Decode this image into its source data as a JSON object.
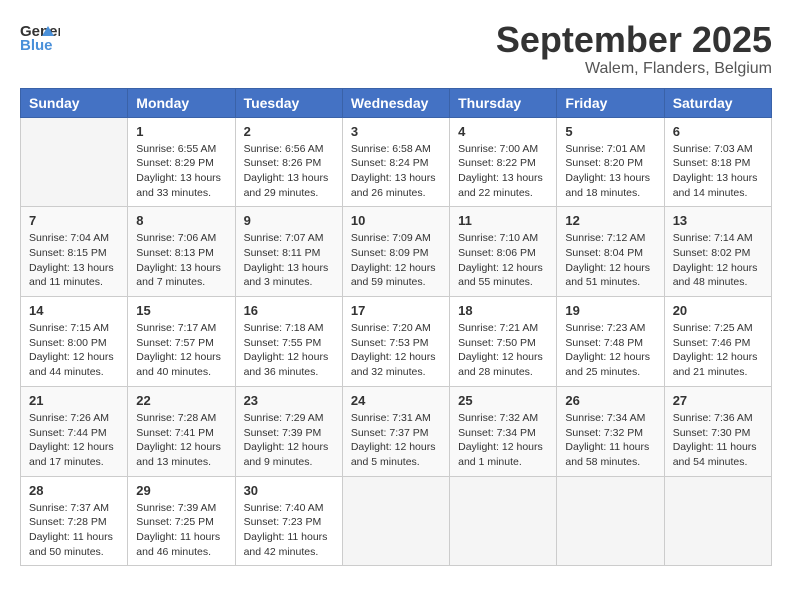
{
  "logo": {
    "general": "General",
    "blue": "Blue"
  },
  "header": {
    "month": "September 2025",
    "location": "Walem, Flanders, Belgium"
  },
  "weekdays": [
    "Sunday",
    "Monday",
    "Tuesday",
    "Wednesday",
    "Thursday",
    "Friday",
    "Saturday"
  ],
  "weeks": [
    [
      {
        "day": "",
        "info": ""
      },
      {
        "day": "1",
        "info": "Sunrise: 6:55 AM\nSunset: 8:29 PM\nDaylight: 13 hours\nand 33 minutes."
      },
      {
        "day": "2",
        "info": "Sunrise: 6:56 AM\nSunset: 8:26 PM\nDaylight: 13 hours\nand 29 minutes."
      },
      {
        "day": "3",
        "info": "Sunrise: 6:58 AM\nSunset: 8:24 PM\nDaylight: 13 hours\nand 26 minutes."
      },
      {
        "day": "4",
        "info": "Sunrise: 7:00 AM\nSunset: 8:22 PM\nDaylight: 13 hours\nand 22 minutes."
      },
      {
        "day": "5",
        "info": "Sunrise: 7:01 AM\nSunset: 8:20 PM\nDaylight: 13 hours\nand 18 minutes."
      },
      {
        "day": "6",
        "info": "Sunrise: 7:03 AM\nSunset: 8:18 PM\nDaylight: 13 hours\nand 14 minutes."
      }
    ],
    [
      {
        "day": "7",
        "info": "Sunrise: 7:04 AM\nSunset: 8:15 PM\nDaylight: 13 hours\nand 11 minutes."
      },
      {
        "day": "8",
        "info": "Sunrise: 7:06 AM\nSunset: 8:13 PM\nDaylight: 13 hours\nand 7 minutes."
      },
      {
        "day": "9",
        "info": "Sunrise: 7:07 AM\nSunset: 8:11 PM\nDaylight: 13 hours\nand 3 minutes."
      },
      {
        "day": "10",
        "info": "Sunrise: 7:09 AM\nSunset: 8:09 PM\nDaylight: 12 hours\nand 59 minutes."
      },
      {
        "day": "11",
        "info": "Sunrise: 7:10 AM\nSunset: 8:06 PM\nDaylight: 12 hours\nand 55 minutes."
      },
      {
        "day": "12",
        "info": "Sunrise: 7:12 AM\nSunset: 8:04 PM\nDaylight: 12 hours\nand 51 minutes."
      },
      {
        "day": "13",
        "info": "Sunrise: 7:14 AM\nSunset: 8:02 PM\nDaylight: 12 hours\nand 48 minutes."
      }
    ],
    [
      {
        "day": "14",
        "info": "Sunrise: 7:15 AM\nSunset: 8:00 PM\nDaylight: 12 hours\nand 44 minutes."
      },
      {
        "day": "15",
        "info": "Sunrise: 7:17 AM\nSunset: 7:57 PM\nDaylight: 12 hours\nand 40 minutes."
      },
      {
        "day": "16",
        "info": "Sunrise: 7:18 AM\nSunset: 7:55 PM\nDaylight: 12 hours\nand 36 minutes."
      },
      {
        "day": "17",
        "info": "Sunrise: 7:20 AM\nSunset: 7:53 PM\nDaylight: 12 hours\nand 32 minutes."
      },
      {
        "day": "18",
        "info": "Sunrise: 7:21 AM\nSunset: 7:50 PM\nDaylight: 12 hours\nand 28 minutes."
      },
      {
        "day": "19",
        "info": "Sunrise: 7:23 AM\nSunset: 7:48 PM\nDaylight: 12 hours\nand 25 minutes."
      },
      {
        "day": "20",
        "info": "Sunrise: 7:25 AM\nSunset: 7:46 PM\nDaylight: 12 hours\nand 21 minutes."
      }
    ],
    [
      {
        "day": "21",
        "info": "Sunrise: 7:26 AM\nSunset: 7:44 PM\nDaylight: 12 hours\nand 17 minutes."
      },
      {
        "day": "22",
        "info": "Sunrise: 7:28 AM\nSunset: 7:41 PM\nDaylight: 12 hours\nand 13 minutes."
      },
      {
        "day": "23",
        "info": "Sunrise: 7:29 AM\nSunset: 7:39 PM\nDaylight: 12 hours\nand 9 minutes."
      },
      {
        "day": "24",
        "info": "Sunrise: 7:31 AM\nSunset: 7:37 PM\nDaylight: 12 hours\nand 5 minutes."
      },
      {
        "day": "25",
        "info": "Sunrise: 7:32 AM\nSunset: 7:34 PM\nDaylight: 12 hours\nand 1 minute."
      },
      {
        "day": "26",
        "info": "Sunrise: 7:34 AM\nSunset: 7:32 PM\nDaylight: 11 hours\nand 58 minutes."
      },
      {
        "day": "27",
        "info": "Sunrise: 7:36 AM\nSunset: 7:30 PM\nDaylight: 11 hours\nand 54 minutes."
      }
    ],
    [
      {
        "day": "28",
        "info": "Sunrise: 7:37 AM\nSunset: 7:28 PM\nDaylight: 11 hours\nand 50 minutes."
      },
      {
        "day": "29",
        "info": "Sunrise: 7:39 AM\nSunset: 7:25 PM\nDaylight: 11 hours\nand 46 minutes."
      },
      {
        "day": "30",
        "info": "Sunrise: 7:40 AM\nSunset: 7:23 PM\nDaylight: 11 hours\nand 42 minutes."
      },
      {
        "day": "",
        "info": ""
      },
      {
        "day": "",
        "info": ""
      },
      {
        "day": "",
        "info": ""
      },
      {
        "day": "",
        "info": ""
      }
    ]
  ]
}
